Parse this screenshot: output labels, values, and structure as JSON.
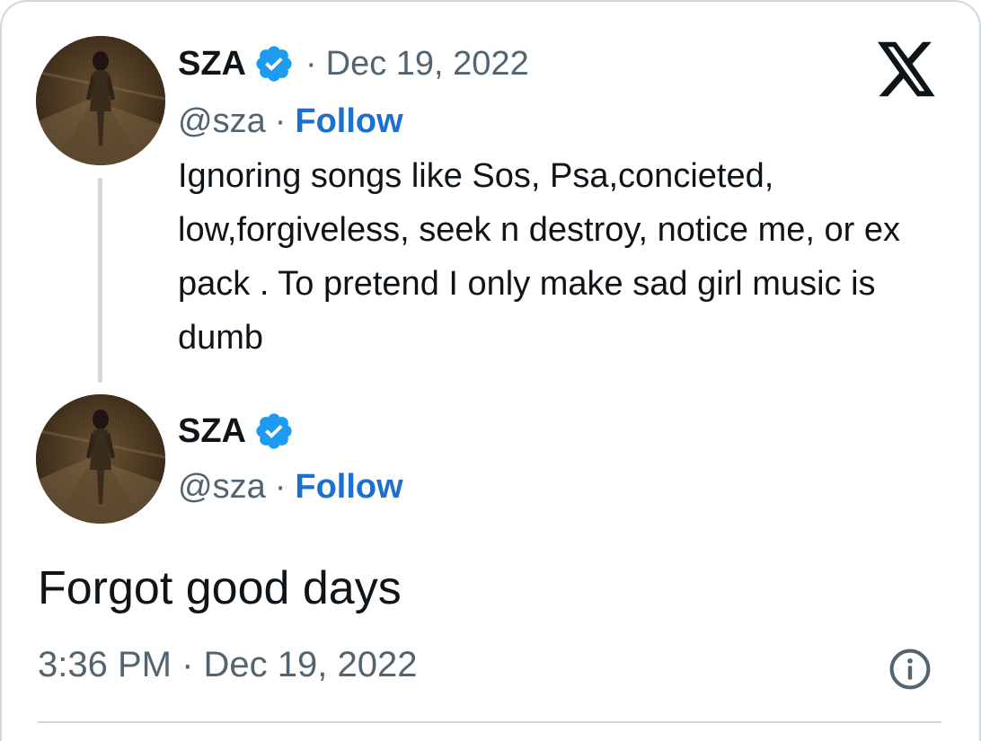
{
  "app": {
    "logo_icon": "x-logo-icon",
    "info_icon": "info-icon",
    "accent_color": "#1d6fd0",
    "verified_color": "#1d9bf0",
    "secondary_text_color": "#536471"
  },
  "quoted_tweet": {
    "author_name": "SZA",
    "verified": true,
    "separator": "·",
    "date": "Dec 19, 2022",
    "handle": "@sza",
    "handle_separator": "·",
    "follow_label": "Follow",
    "text": "Ignoring songs like Sos, Psa,concieted, low,forgiveless, seek n destroy, notice me, or ex pack . To pretend I only make sad girl music is dumb"
  },
  "main_tweet": {
    "author_name": "SZA",
    "verified": true,
    "handle": "@sza",
    "handle_separator": "·",
    "follow_label": "Follow",
    "text": "Forgot good days",
    "timestamp": "3:36 PM · Dec 19, 2022"
  }
}
